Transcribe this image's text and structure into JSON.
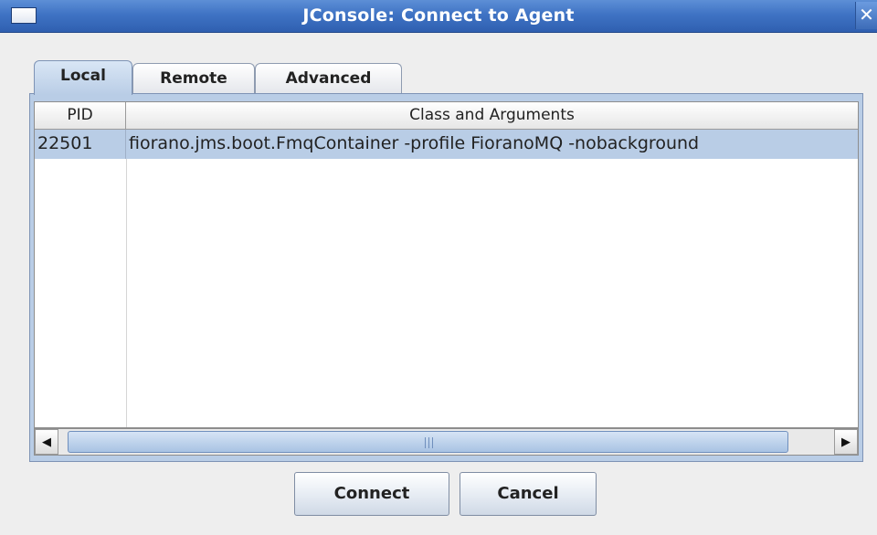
{
  "window": {
    "title": "JConsole: Connect to Agent",
    "close_glyph": "✕"
  },
  "tabs": [
    {
      "label": "Local",
      "selected": true
    },
    {
      "label": "Remote",
      "selected": false
    },
    {
      "label": "Advanced",
      "selected": false
    }
  ],
  "table": {
    "columns": [
      "PID",
      "Class and Arguments"
    ],
    "rows": [
      {
        "pid": "22501",
        "args": "fiorano.jms.boot.FmqContainer -profile FioranoMQ -nobackground",
        "selected": true
      }
    ]
  },
  "scrollbar": {
    "left_arrow": "◀",
    "right_arrow": "▶"
  },
  "buttons": {
    "connect": "Connect",
    "cancel": "Cancel"
  },
  "colors": {
    "titlebar": "#3f73c4",
    "selection": "#b9cde6",
    "background": "#eeeeee"
  }
}
